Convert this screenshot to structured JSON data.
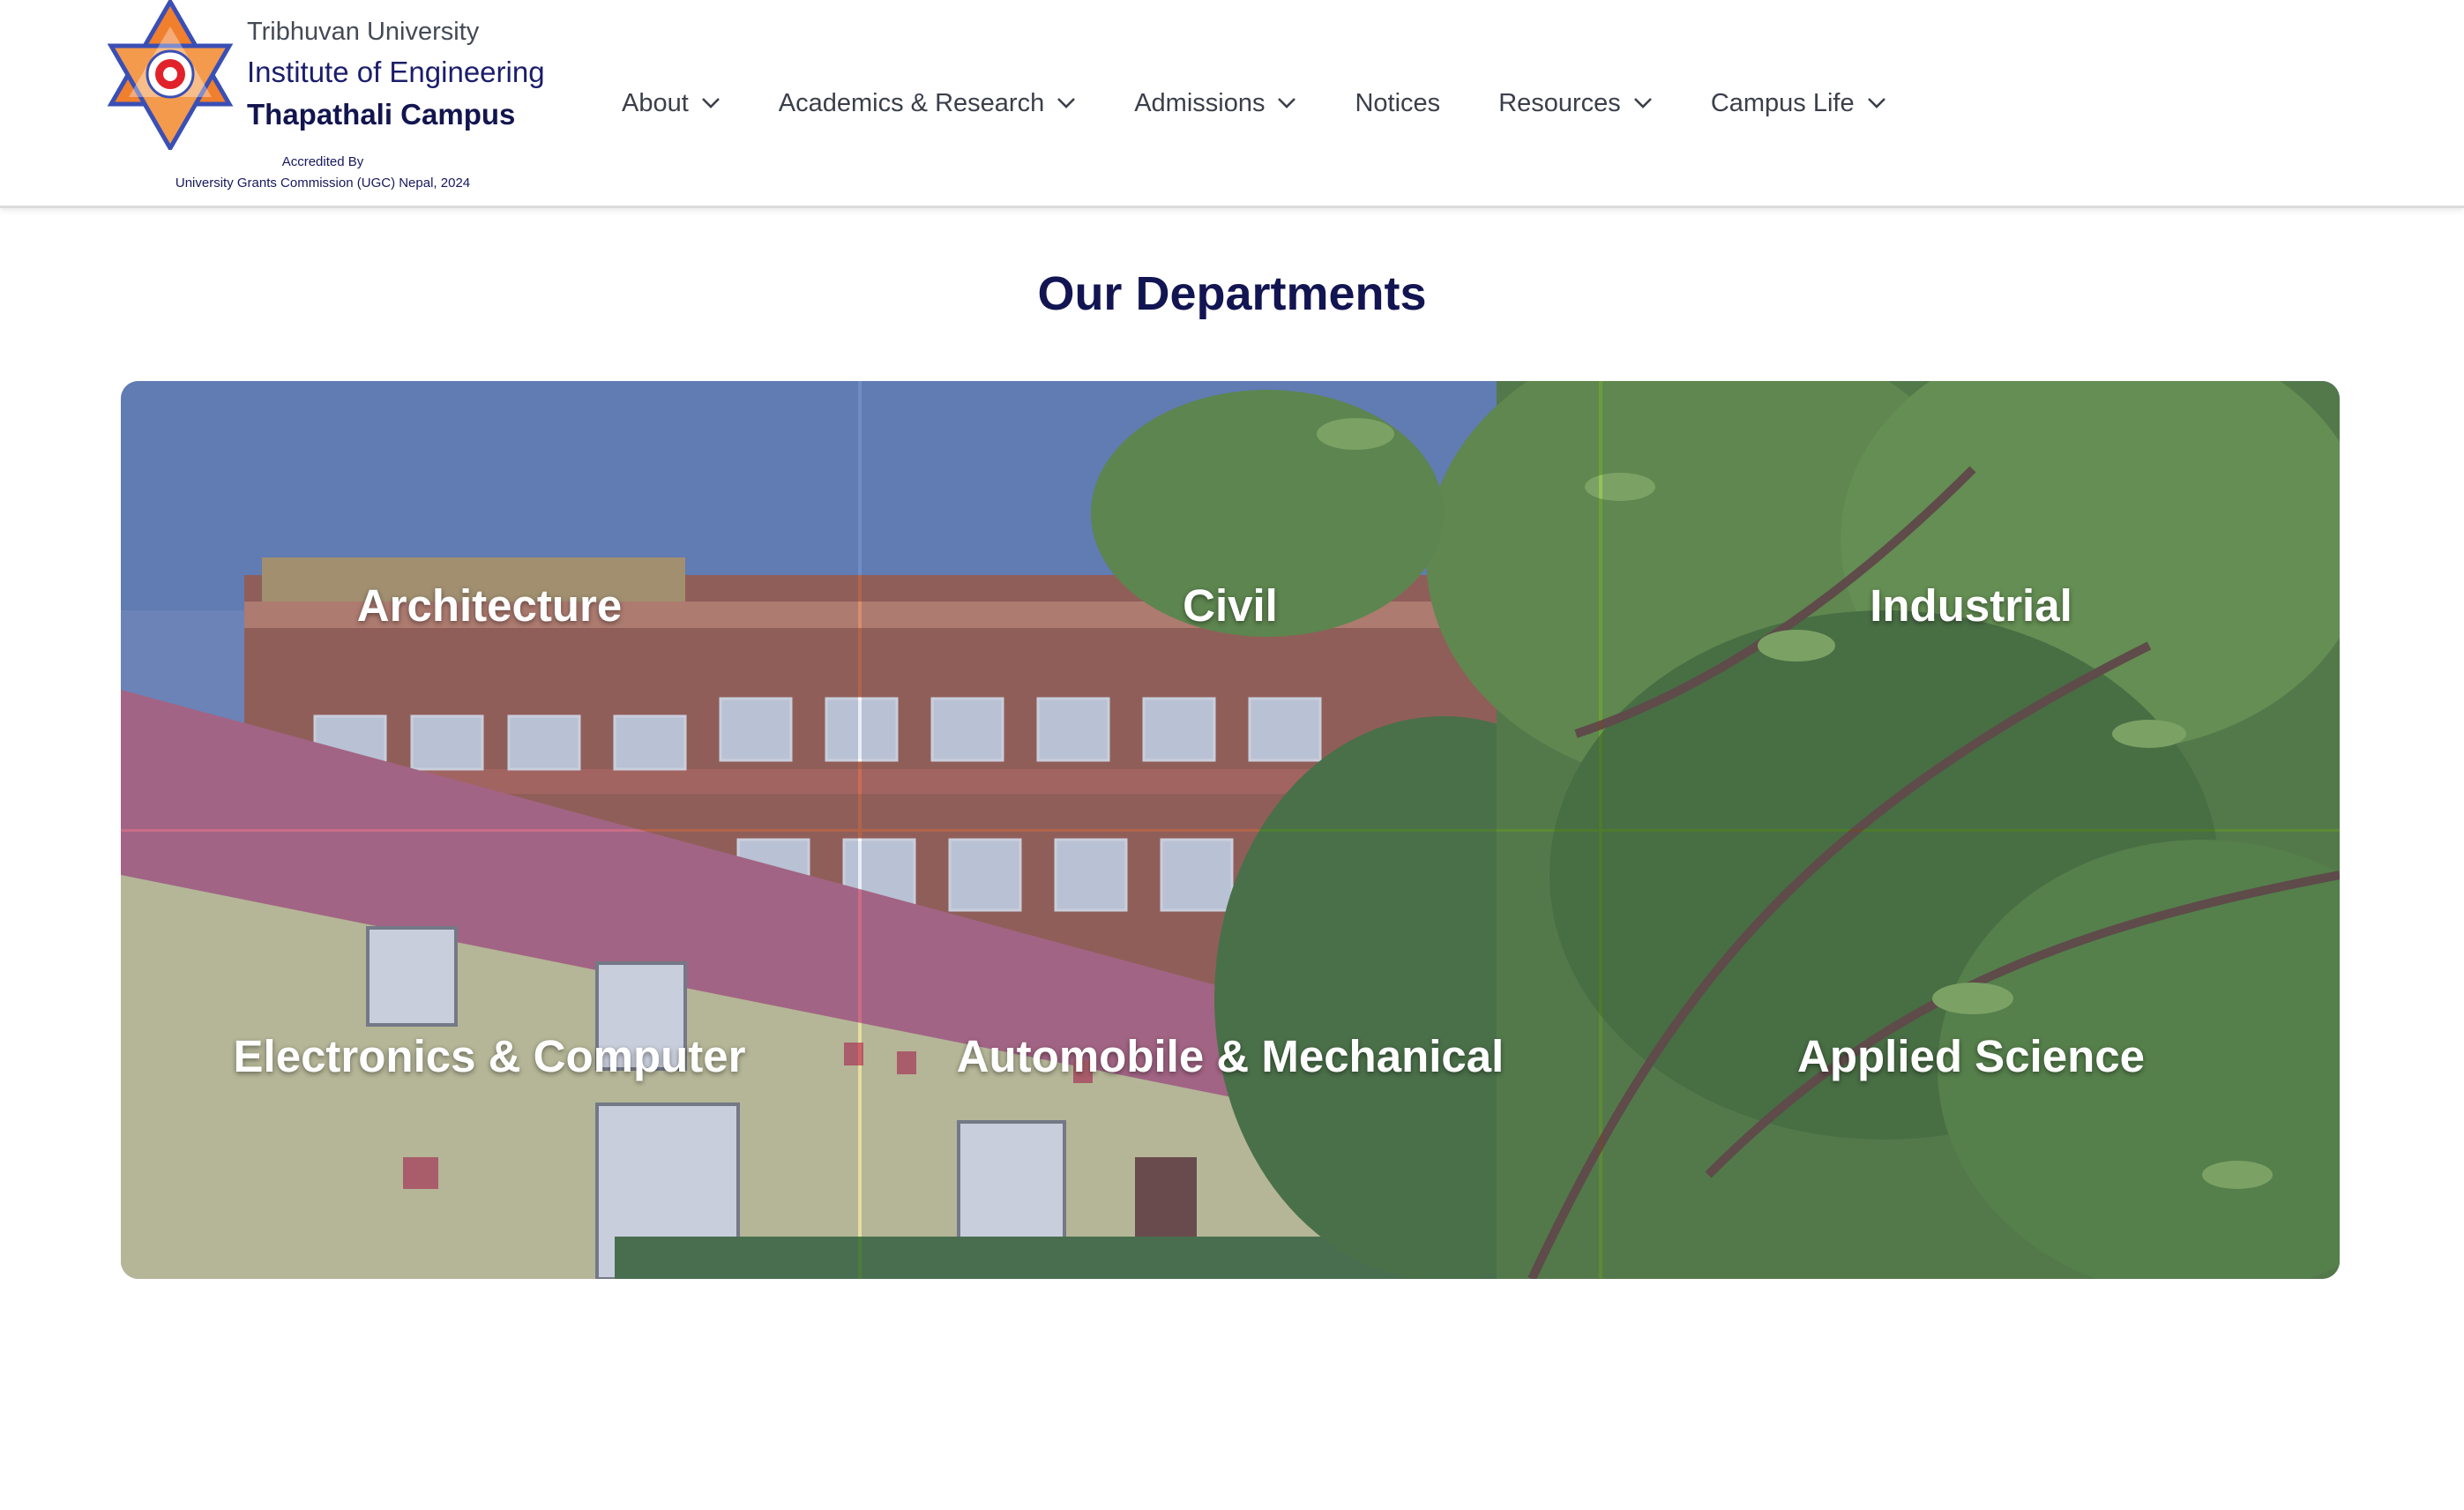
{
  "header": {
    "university": "Tribhuvan University",
    "institute": "Institute of Engineering",
    "campus": "Thapathali Campus",
    "accredited_by": "Accredited By",
    "accreditation": "University Grants Commission (UGC) Nepal, 2024",
    "logo_icon": "campus-logo-star-icon"
  },
  "nav": {
    "items": [
      {
        "label": "About",
        "has_dropdown": true
      },
      {
        "label": "Academics & Research",
        "has_dropdown": true
      },
      {
        "label": "Admissions",
        "has_dropdown": true
      },
      {
        "label": "Notices",
        "has_dropdown": false
      },
      {
        "label": "Resources",
        "has_dropdown": true
      },
      {
        "label": "Campus Life",
        "has_dropdown": true
      }
    ],
    "dropdown_icon": "chevron-down-icon"
  },
  "departments": {
    "title": "Our Departments",
    "items": [
      {
        "label": "Architecture"
      },
      {
        "label": "Civil"
      },
      {
        "label": "Industrial"
      },
      {
        "label": "Electronics & Computer"
      },
      {
        "label": "Automobile & Mechanical"
      },
      {
        "label": "Applied Science"
      }
    ]
  },
  "colors": {
    "brand_navy": "#121552",
    "nav_text": "#3a3f4a",
    "logo_orange": "#f07f2e",
    "logo_blue": "#3a4fb5",
    "overlay": "#3c5082"
  }
}
